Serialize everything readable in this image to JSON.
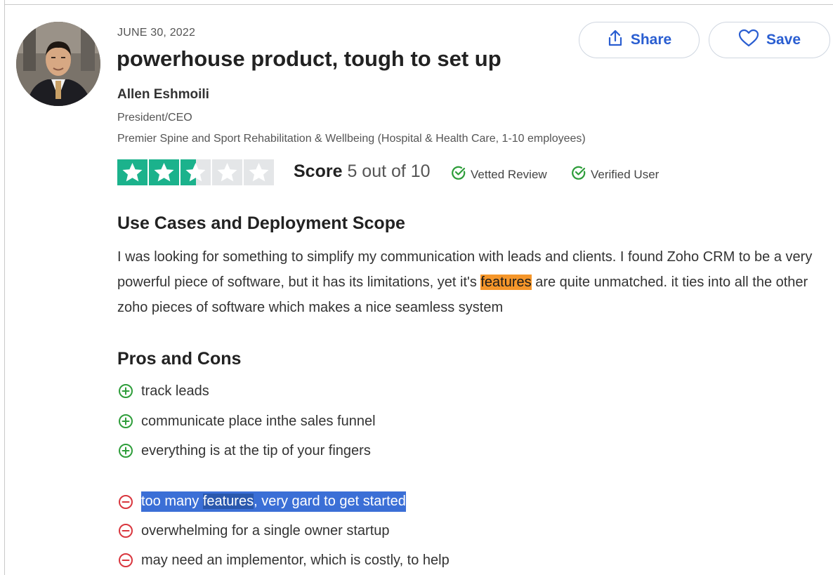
{
  "review": {
    "date": "JUNE 30, 2022",
    "title": "powerhouse product, tough to set up",
    "author": "Allen Eshmoili",
    "role": "President/CEO",
    "company": "Premier Spine and Sport Rehabilitation & Wellbeing (Hospital & Health Care, 1-10 employees)"
  },
  "actions": {
    "share_label": "Share",
    "save_label": "Save"
  },
  "rating": {
    "stars_total": 5,
    "stars_filled": 2.5,
    "score_label": "Score",
    "score_value": "5 out of 10",
    "star_color": "#1bb28c"
  },
  "badges": {
    "vetted": "Vetted Review",
    "verified": "Verified User",
    "color": "#2e9d3a"
  },
  "use_cases": {
    "heading": "Use Cases and Deployment Scope",
    "text_before": "I was looking for something to simplify my communication with leads and clients. I found Zoho CRM to be a very powerful piece of software, but it has its limitations, yet it's ",
    "highlight": "features",
    "text_after": " are quite unmatched. it ties into all the other zoho pieces of software which makes a nice seamless system"
  },
  "pros_cons": {
    "heading": "Pros and Cons",
    "pros": [
      "track leads",
      "communicate place inthe sales funnel",
      "everything is at the tip of your fingers"
    ],
    "cons": [
      {
        "before": "too many ",
        "highlight": "features",
        "after": ", very gard to get started"
      },
      {
        "text": "overwhelming for a single owner startup"
      },
      {
        "text": "may need an implementor, which is costly, to help"
      }
    ],
    "pro_color": "#2e9d3a",
    "con_color": "#d9363e"
  },
  "icons": {
    "share": "share-icon",
    "save": "heart-icon",
    "pro": "plus-circle-icon",
    "con": "minus-circle-icon",
    "check": "check-circle-icon"
  }
}
